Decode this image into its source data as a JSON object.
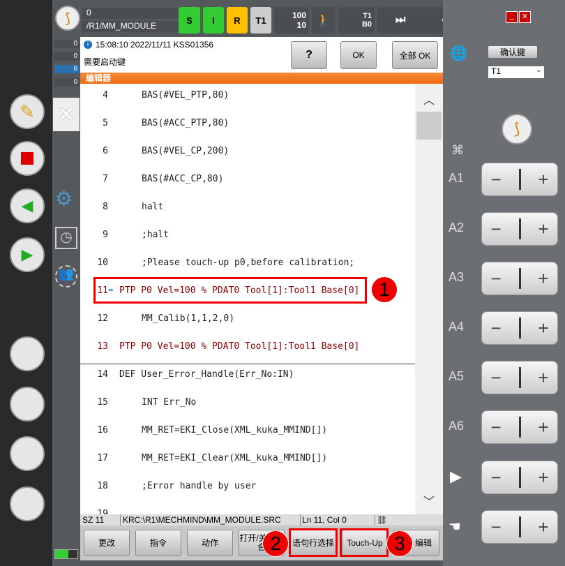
{
  "header": {
    "program_line": "0",
    "program_path": "/R1/MM_MODULE",
    "status_s": "S",
    "status_i": "I",
    "status_r": "R",
    "mode": "T1",
    "override_prog": "100",
    "override_jog": "10",
    "tool_label": "T1",
    "base_label": "B0",
    "run_mode": "∞"
  },
  "message": {
    "time": "15:08:10 2022/11/11 KSS01356",
    "text": "需要启动键",
    "help": "?",
    "ok": "OK",
    "all_ok": "全部 OK",
    "counts": [
      "0",
      "0",
      "6",
      "0"
    ]
  },
  "editor": {
    "title": "编辑器",
    "lines": [
      {
        "n": "4",
        "t": "BAS(#VEL_PTP,80)",
        "indent": true
      },
      {
        "n": "5",
        "t": "BAS(#ACC_PTP,80)",
        "indent": true
      },
      {
        "n": "6",
        "t": "BAS(#VEL_CP,200)",
        "indent": true
      },
      {
        "n": "7",
        "t": "BAS(#ACC_CP,80)",
        "indent": true
      },
      {
        "n": "8",
        "t": "halt",
        "indent": true
      },
      {
        "n": "9",
        "t": ";halt",
        "indent": true
      },
      {
        "n": "10",
        "t": ";Please touch-up p0,before calibration;",
        "indent": true
      },
      {
        "n": "11",
        "t": "PTP P0 Vel=100 % PDAT0 Tool[1]:Tool1 Base[0]",
        "indent": false,
        "red": true
      },
      {
        "n": "12",
        "t": "MM_Calib(1,1,2,0)",
        "indent": true
      },
      {
        "n": "13",
        "t": "PTP P0 Vel=100 % PDAT0 Tool[1]:Tool1 Base[0]",
        "indent": false,
        "red": true
      },
      {
        "n": "14",
        "t": "DEF User_Error_Handle(Err_No:IN)",
        "indent": false
      },
      {
        "n": "15",
        "t": "INT Err_No",
        "indent": true
      },
      {
        "n": "16",
        "t": "MM_RET=EKI_Close(XML_kuka_MMIND[])",
        "indent": true
      },
      {
        "n": "17",
        "t": "MM_RET=EKI_Clear(XML_kuka_MMIND[])",
        "indent": true
      },
      {
        "n": "18",
        "t": ";Error handle by user",
        "indent": true
      }
    ]
  },
  "statusbar": {
    "sz": "SZ 11",
    "path": "KRC:\\R1\\MECHMIND\\MM_MODULE.SRC",
    "pos": "Ln 11, Col 0"
  },
  "buttons": {
    "change": "更改",
    "command": "指令",
    "motion": "动作",
    "fold": "打开/关闭折合",
    "line_select": "语句行选择",
    "touchup": "Touch-Up",
    "edit": "编辑"
  },
  "badges": [
    "1",
    "2",
    "3"
  ],
  "right": {
    "confirm": "确认键",
    "mode_select": "T1",
    "axes": [
      "A1",
      "A2",
      "A3",
      "A4",
      "A5",
      "A6"
    ]
  },
  "colors": {
    "accent": "#f07a1a",
    "highlight": "#e00000",
    "ok_green": "#33dd33",
    "run_yellow": "#ffc000"
  }
}
